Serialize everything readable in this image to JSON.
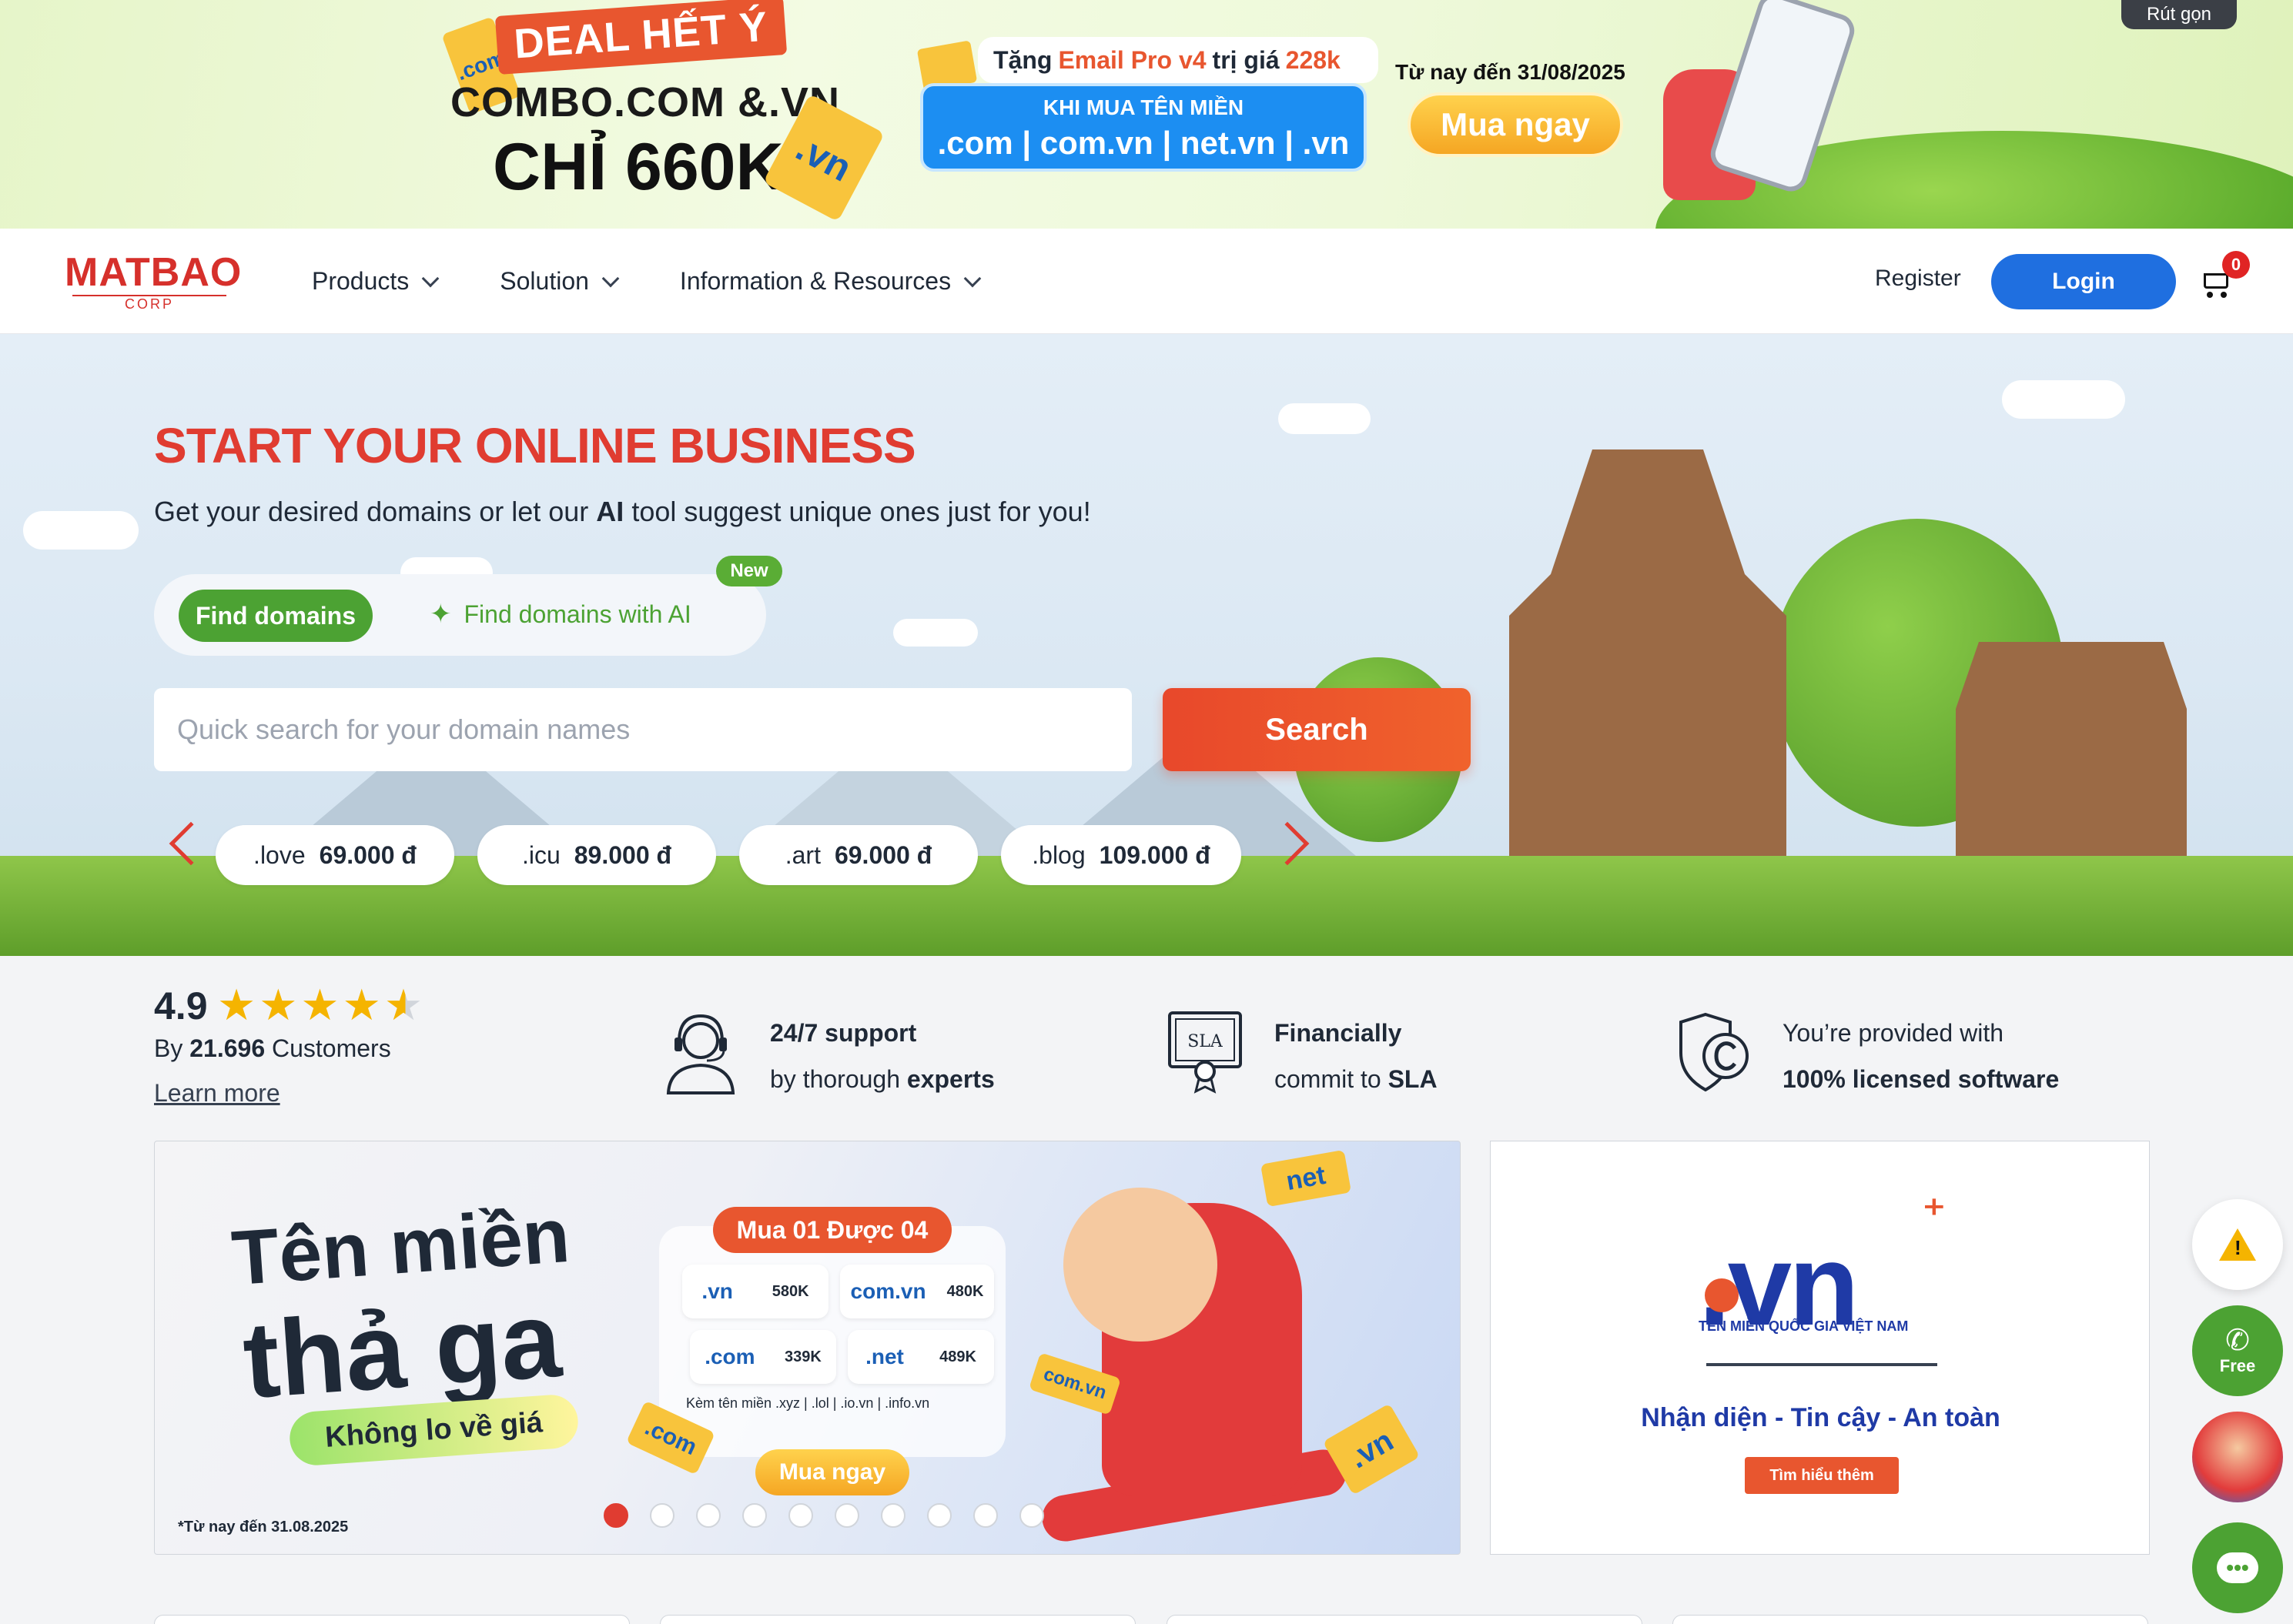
{
  "promo": {
    "deal": "DEAL HẾT Ý",
    "combo": "COMBO.COM &.VN",
    "price_line": "CHỈ 660K",
    "gift_prefix": "Tặng",
    "gift_product": "Email Pro v4",
    "gift_suffix": "trị giá",
    "gift_value": "228k",
    "buy_domain": "KHI MUA  TÊN MIỀN",
    "domain_list": ".com | com.vn | net.vn | .vn",
    "date": "Từ nay đến 31/08/2025",
    "buy_now": "Mua ngay",
    "collapse": "Rút gọn",
    "tag_vn": ".vn",
    "tag_com": ".com"
  },
  "header": {
    "logo_main": "MATBAO",
    "logo_sub": "CORP",
    "nav": [
      "Products",
      "Solution",
      "Information & Resources"
    ],
    "register": "Register",
    "login": "Login",
    "cart_count": "0"
  },
  "hero": {
    "title": "START YOUR ONLINE BUSINESS",
    "subtitle_before": "Get your desired domains or let our",
    "subtitle_ai": "AI",
    "subtitle_after": "tool suggest unique ones just for you!",
    "tab_find": "Find domains",
    "tab_ai": "Find domains with AI",
    "new_badge": "New",
    "search_placeholder": "Quick search for your domain names",
    "search_button": "Search",
    "prices": [
      {
        "tld": ".love",
        "price": "69.000 đ"
      },
      {
        "tld": ".icu",
        "price": "89.000 đ"
      },
      {
        "tld": ".art",
        "price": "69.000 đ"
      },
      {
        "tld": ".blog",
        "price": "109.000 đ"
      }
    ]
  },
  "stats": {
    "rating": "4.9",
    "rating_value": 4.9,
    "customers_prefix": "By",
    "customers_count": "21.696",
    "customers_suffix": "Customers",
    "learn_more": "Learn more",
    "features": [
      {
        "line1": "24/7 support",
        "line2_plain": "by thorough",
        "line2_bold": "experts",
        "icon": "headset-icon"
      },
      {
        "line1": "Financially",
        "line2_plain": "commit to",
        "line2_bold": "SLA",
        "icon": "sla-certificate-icon"
      },
      {
        "line1": "You’re provided with",
        "line2_plain": "",
        "line2_bold": "100% licensed software",
        "icon": "shield-copyright-icon"
      }
    ]
  },
  "slider": {
    "title1": "Tên miền",
    "title2": "thả ga",
    "pill": "Không lo về giá",
    "offer": "Mua 01 Được 04",
    "prices": [
      {
        "tld": ".vn",
        "amount": "580K"
      },
      {
        "tld": "com.vn",
        "amount": "480K"
      },
      {
        "tld": ".com",
        "amount": "339K"
      },
      {
        "tld": ".net",
        "amount": "489K"
      }
    ],
    "footnote": "Kèm tên miền .xyz | .lol | .io.vn | .info.vn",
    "buy_now": "Mua ngay",
    "note": "*Từ nay đến 31.08.2025",
    "tag_net": "net",
    "tag_comvn": "com.vn",
    "tag_com": ".com",
    "tag_vn": ".vn",
    "slide_count": 10,
    "active_slide": 1
  },
  "vn_card": {
    "mark": ".vn",
    "small": "TÊN MIỀN QUỐC GIA VIỆT NAM",
    "slogan": "Nhận diện - Tin cậy - An toàn",
    "button": "Tìm hiểu thêm"
  },
  "widgets": {
    "phone_label": "Free"
  }
}
